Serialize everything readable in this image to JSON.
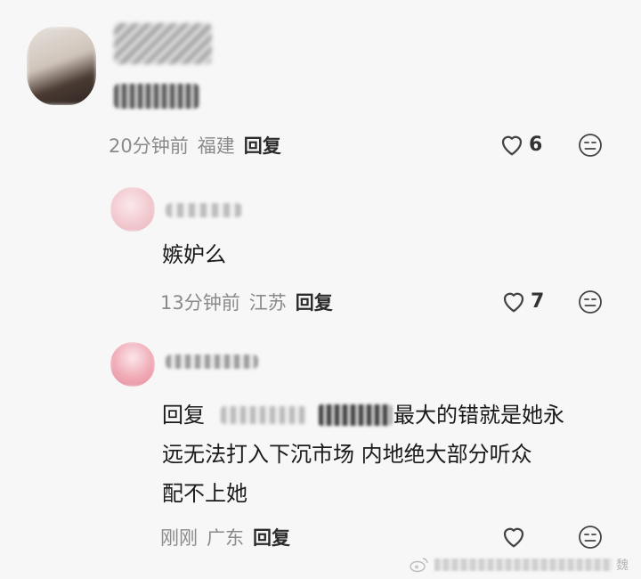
{
  "comments": [
    {
      "text_visible": "",
      "time": "20分钟前",
      "location": "福建",
      "reply_label": "回复",
      "likes": "6"
    },
    {
      "text": "嫉妒么",
      "time": "13分钟前",
      "location": "江苏",
      "reply_label": "回复",
      "likes": "7"
    },
    {
      "reply_prefix": "回复",
      "text_line1_tail": "最大的错就是她永",
      "text_line2": "远无法打入下沉市场 内地绝大部分听众",
      "text_line3": "配不上她",
      "time": "刚刚",
      "location": "广东",
      "reply_label": "回复",
      "likes": ""
    }
  ],
  "watermark": {
    "tail": "魏"
  },
  "icons": {
    "like": "heart-outline-icon",
    "emoji": "neutral-face-icon",
    "watermark_logo": "weibo-logo-icon"
  },
  "colors": {
    "background": "#f7f7f7",
    "meta_text": "#8a8a8a",
    "strong_text": "#1a1a1a"
  }
}
